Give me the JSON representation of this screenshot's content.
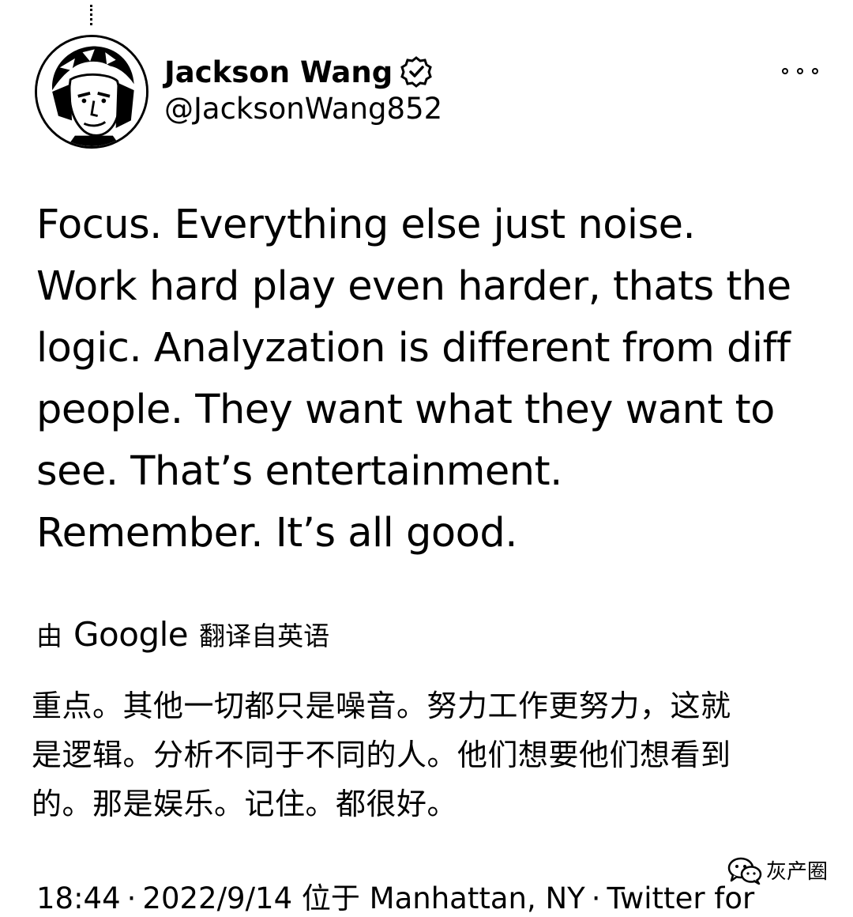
{
  "author": {
    "display_name": "Jackson Wang",
    "handle": "@JacksonWang852",
    "verified_icon": "verified-badge-icon",
    "avatar": "profile-photo"
  },
  "more_icon": "more-options-icon",
  "tweet": {
    "text": "Focus. Everything else just noise.\nWork hard play even harder, thats the\nlogic. Analyzation is different from diff\npeople. They want what they want to\nsee. That’s entertainment.\nRemember. It’s all good."
  },
  "translation": {
    "prefix": "由",
    "service": "Google",
    "suffix": "翻译自英语",
    "lines": [
      "重点。其他一切都只是噪音。努力工作更努力，这就",
      "是逻辑。分析不同于不同的人。他们想要他们想看到",
      "的。那是娱乐。记住。都很好。"
    ]
  },
  "watermark": {
    "icon": "wechat-icon",
    "text": "灰产圈"
  },
  "meta": {
    "time": "18:44",
    "separator": "·",
    "date": "2022/9/14",
    "location": "位于 Manhattan, NY",
    "source": "Twitter for"
  }
}
